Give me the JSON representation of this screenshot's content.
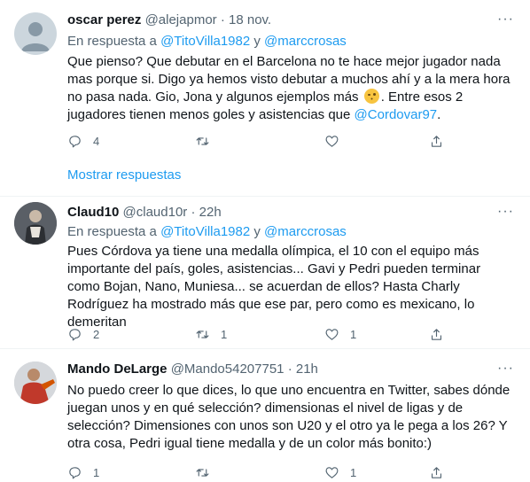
{
  "icons": {
    "more": "more-horizontal-icon",
    "reply": "reply-icon",
    "retweet": "retweet-icon",
    "like": "heart-icon",
    "share": "share-icon"
  },
  "colors": {
    "link": "#1d9bf0",
    "muted": "#536471",
    "text": "#0f1419",
    "divider": "#eff3f4"
  },
  "show_more_replies": "Mostrar respuestas",
  "tweets": [
    {
      "name": "oscar perez",
      "handle": "@alejapmor",
      "sep": "·",
      "time": "18 nov.",
      "more": "···",
      "reply_prefix": "En respuesta a",
      "reply_to_1": "@TitoVilla1982",
      "reply_and": "y",
      "reply_to_2": "@marccrosas",
      "text_before": "Que pienso? Que debutar en el Barcelona no te hace mejor jugador nada mas porque si. Digo ya hemos visto debutar a muchos ahí y a la mera hora no pasa nada. Gio, Jona y algunos ejemplos más",
      "text_middle": ". Entre esos 2 jugadores tienen menos goles y asistencias que",
      "mention": "@Cordovar97",
      "text_after": ".",
      "replies": "4",
      "retweets": "",
      "likes": ""
    },
    {
      "name": "Claud10",
      "handle": "@claud10r",
      "sep": "·",
      "time": "22h",
      "more": "···",
      "reply_prefix": "En respuesta a",
      "reply_to_1": "@TitoVilla1982",
      "reply_and": "y",
      "reply_to_2": "@marccrosas",
      "text": "Pues Córdova ya tiene una medalla olímpica, el 10 con el equipo más importante del país, goles, asistencias... Gavi y Pedri pueden terminar como Bojan, Nano, Muniesa... se acuerdan de ellos? Hasta Charly Rodríguez ha mostrado más que ese par, pero como es mexicano, lo demeritan",
      "replies": "2",
      "retweets": "1",
      "likes": "1"
    },
    {
      "name": "Mando DeLarge",
      "handle": "@Mando54207751",
      "sep": "·",
      "time": "21h",
      "more": "···",
      "text": "No puedo creer lo que dices, lo que uno encuentra en Twitter, sabes dónde juegan unos y en qué selección? dimensionas el nivel de ligas y de selección? Dimensiones con unos son U20 y el otro ya le pega a los 26? Y otra cosa, Pedri igual tiene medalla y de un color más bonito:)",
      "replies": "1",
      "retweets": "",
      "likes": "1"
    }
  ]
}
